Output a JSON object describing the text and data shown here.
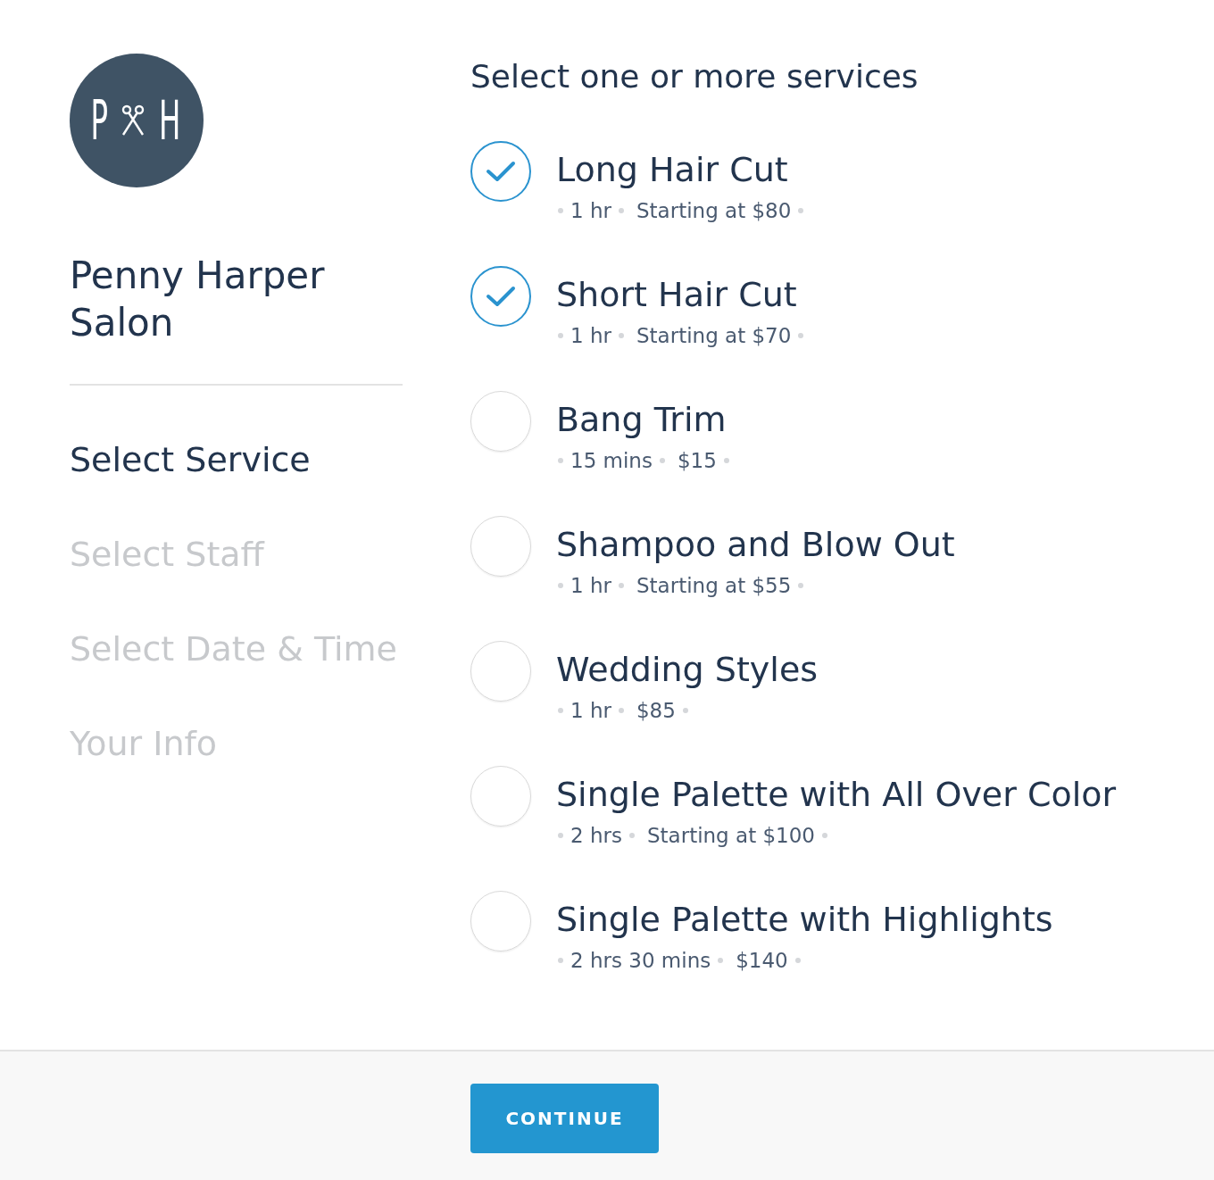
{
  "salon": {
    "logo_letters": [
      "P",
      "H"
    ],
    "name": "Penny Harper Salon"
  },
  "steps": [
    {
      "label": "Select Service",
      "selected": true
    },
    {
      "label": "Select Staff",
      "selected": false
    },
    {
      "label": "Select Date & Time",
      "selected": false
    },
    {
      "label": "Your Info",
      "selected": false
    }
  ],
  "heading": "Select one or more services",
  "services": [
    {
      "name": "Long Hair Cut",
      "duration": "1 hr",
      "price": "Starting at $80",
      "checked": true
    },
    {
      "name": "Short Hair Cut",
      "duration": "1 hr",
      "price": "Starting at $70",
      "checked": true
    },
    {
      "name": "Bang Trim",
      "duration": "15 mins",
      "price": "$15",
      "checked": false
    },
    {
      "name": "Shampoo and Blow Out",
      "duration": "1 hr",
      "price": "Starting at $55",
      "checked": false
    },
    {
      "name": "Wedding Styles",
      "duration": "1 hr",
      "price": "$85",
      "checked": false
    },
    {
      "name": "Single Palette with All Over Color",
      "duration": "2 hrs",
      "price": "Starting at $100",
      "checked": false
    },
    {
      "name": "Single Palette with Highlights",
      "duration": "2 hrs 30 mins",
      "price": "$140",
      "checked": false
    }
  ],
  "footer": {
    "button": "CONTINUE"
  }
}
